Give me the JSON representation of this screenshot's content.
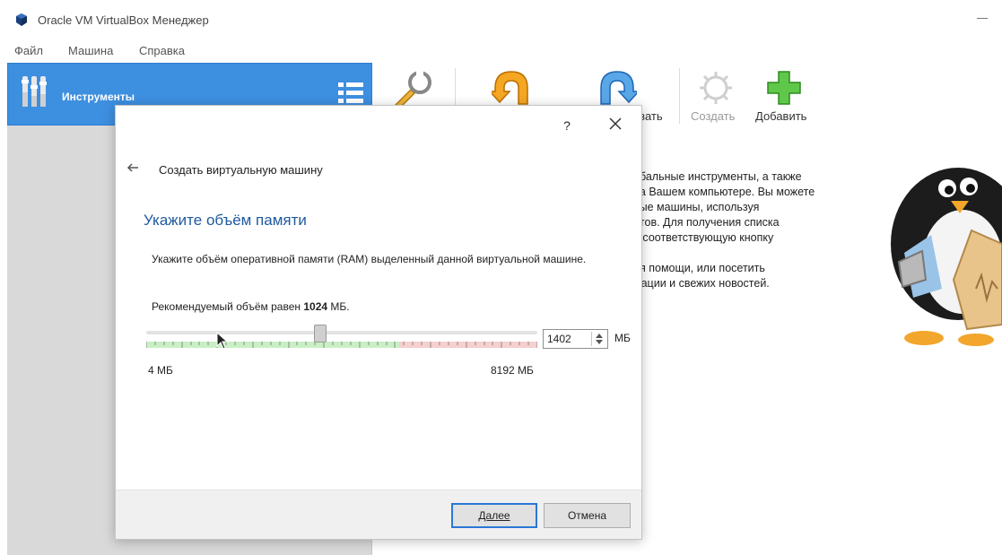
{
  "window": {
    "title": "Oracle VM VirtualBox Менеджер"
  },
  "menu": {
    "items": [
      "Файл",
      "Машина",
      "Справка"
    ]
  },
  "sidebar": {
    "tools_label": "Инструменты"
  },
  "toolbar": {
    "items": [
      {
        "label": "",
        "icon": "wrench-icon"
      },
      {
        "label": "",
        "icon": "discard-icon"
      },
      {
        "label": "зать",
        "icon": "show-icon"
      },
      {
        "label": "Создать",
        "icon": "gear-create-icon",
        "disabled": true
      },
      {
        "label": "Добавить",
        "icon": "plus-icon"
      }
    ]
  },
  "welcome": {
    "paragraph1": [
      "обальные инструменты, а также",
      "на Вашем компьютере. Вы можете",
      "вые машины, используя",
      "нтов. Для получения списка",
      "е соответствующую кнопку"
    ],
    "paragraph2": [
      "ия помощи, или посетить",
      "мации и свежих новостей."
    ]
  },
  "dialog": {
    "help": "?",
    "wizard_title": "Создать виртуальную машину",
    "heading": "Укажите объём памяти",
    "description": "Укажите объём оперативной памяти (RAM) выделенный данной виртуальной машине.",
    "recommend_prefix": "Рекомендуемый объём равен ",
    "recommend_value": "1024",
    "recommend_suffix": " МБ.",
    "slider": {
      "min": 4,
      "max": 8192,
      "value": 1402,
      "safe_limit_fraction": 0.647,
      "min_label": "4 МБ",
      "max_label": "8192 МБ"
    },
    "memory_value": "1402",
    "unit": "МБ",
    "next_label": "Далее",
    "cancel_label": "Отмена"
  },
  "colors": {
    "accent": "#3d8fe0",
    "heading": "#1f5aa0",
    "safe_zone": "#c9efc4",
    "danger_zone": "#f6cfcf"
  }
}
